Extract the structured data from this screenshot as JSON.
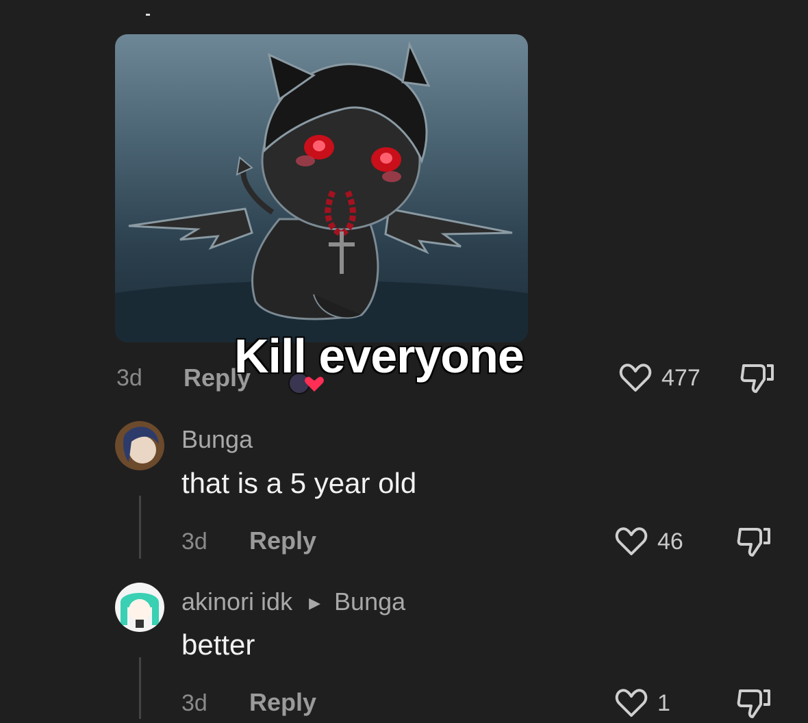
{
  "overlay_caption": "Kill everyone",
  "top_comment": {
    "time": "3d",
    "reply_label": "Reply",
    "like_count": "477"
  },
  "comments": [
    {
      "username": "Bunga",
      "text": "that is a 5 year old",
      "time": "3d",
      "reply_label": "Reply",
      "like_count": "46"
    },
    {
      "username": "akinori idk",
      "reply_to": "Bunga",
      "text": "better",
      "time": "3d",
      "reply_label": "Reply",
      "like_count": "1"
    }
  ],
  "icons": {
    "like": "heart-outline-icon",
    "dislike": "thumbs-down-icon",
    "reply_arrow": "caret-right-icon"
  },
  "colors": {
    "background": "#1f1f1f",
    "secondary_text": "#8a8a8a",
    "reaction_heart": "#ff2e55"
  }
}
